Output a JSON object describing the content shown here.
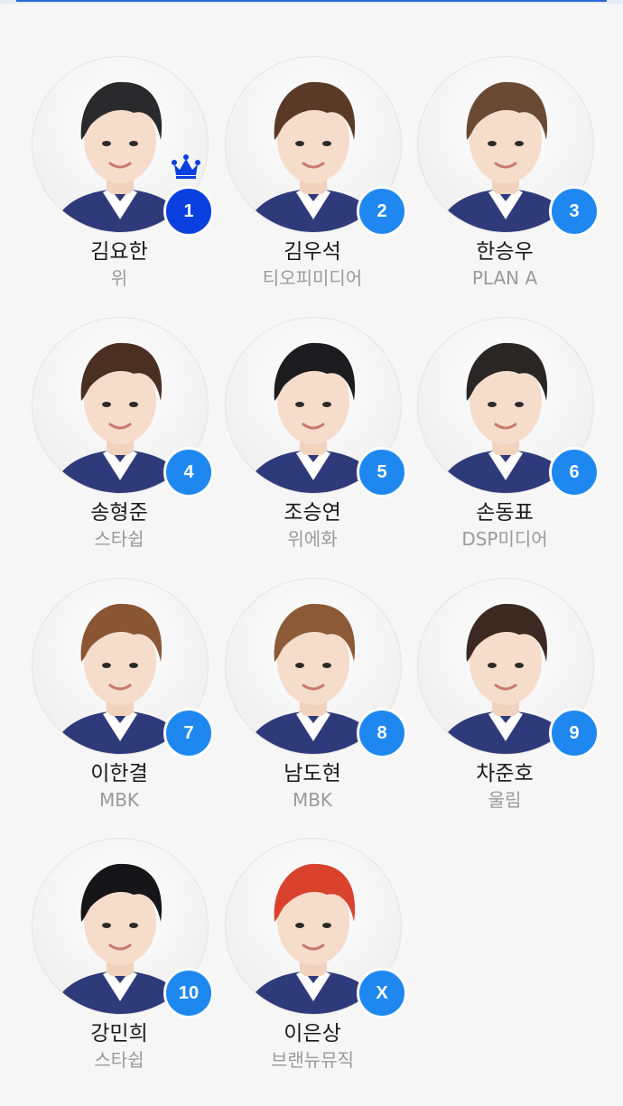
{
  "colors": {
    "badge": "#1e88f0",
    "badge_first": "#0a3fe0",
    "name": "#1a1a1a",
    "agency": "#9a9a9a",
    "crown": "#0a3fe0"
  },
  "trainees": [
    {
      "rank": "1",
      "name": "김요한",
      "agency": "위",
      "hair": "#2a2a2c",
      "crown": true
    },
    {
      "rank": "2",
      "name": "김우석",
      "agency": "티오피미디어",
      "hair": "#5a3a26"
    },
    {
      "rank": "3",
      "name": "한승우",
      "agency": "PLAN A",
      "hair": "#6b4a34"
    },
    {
      "rank": "4",
      "name": "송형준",
      "agency": "스타쉽",
      "hair": "#4a2f22"
    },
    {
      "rank": "5",
      "name": "조승연",
      "agency": "위에화",
      "hair": "#1d1d1f"
    },
    {
      "rank": "6",
      "name": "손동표",
      "agency": "DSP미디어",
      "hair": "#2a2626"
    },
    {
      "rank": "7",
      "name": "이한결",
      "agency": "MBK",
      "hair": "#8a5532"
    },
    {
      "rank": "8",
      "name": "남도현",
      "agency": "MBK",
      "hair": "#8c5a36"
    },
    {
      "rank": "9",
      "name": "차준호",
      "agency": "울림",
      "hair": "#3c2a22"
    },
    {
      "rank": "10",
      "name": "강민희",
      "agency": "스타쉽",
      "hair": "#161618"
    },
    {
      "rank": "X",
      "name": "이은상",
      "agency": "브랜뉴뮤직",
      "hair": "#d9432e"
    }
  ]
}
